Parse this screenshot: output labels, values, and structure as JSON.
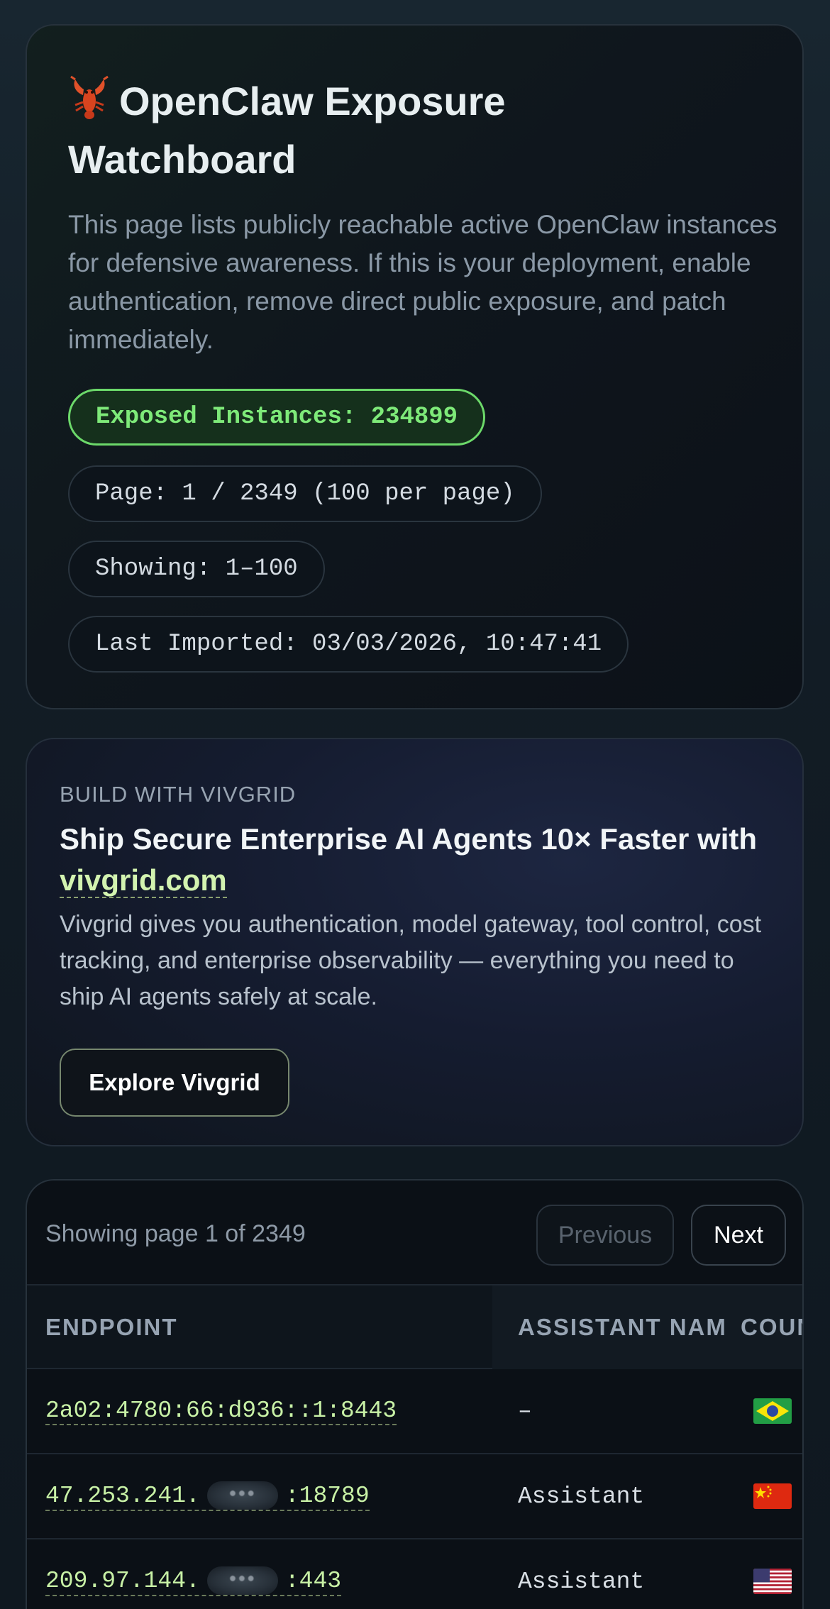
{
  "hero": {
    "title": "OpenClaw Exposure Watchboard",
    "description": "This page lists publicly reachable active OpenClaw instances for defensive awareness. If this is your deployment, enable authentication, remove direct public exposure, and patch immediately.",
    "exposed_label": "Exposed Instances: 234899",
    "page_label": "Page: 1 / 2349 (100 per page)",
    "showing_label": "Showing: 1–100",
    "imported_label": "Last Imported: 03/03/2026, 10:47:41"
  },
  "promo": {
    "eyebrow": "BUILD WITH VIVGRID",
    "title_prefix": "Ship Secure Enterprise AI Agents 10× Faster with ",
    "title_link": "vivgrid.com",
    "description": "Vivgrid gives you authentication, model gateway, tool control, cost tracking, and enterprise observability — everything you need to ship AI agents safely at scale.",
    "button": "Explore Vivgrid"
  },
  "table": {
    "status": "Showing page 1 of 2349",
    "prev_label": "Previous",
    "next_label": "Next",
    "columns": [
      "ENDPOINT",
      "ASSISTANT NAM",
      "COUN"
    ],
    "rows": [
      {
        "endpoint_prefix": "2a02:4780:66:d936::1:8443",
        "endpoint_suffix": "",
        "assistant": "–",
        "country": "Br",
        "flag": "brazil-flag-icon"
      },
      {
        "endpoint_prefix": "47.253.241.",
        "endpoint_suffix": ":18789",
        "assistant": "Assistant",
        "country": "C",
        "flag": "china-flag-icon"
      },
      {
        "endpoint_prefix": "209.97.144.",
        "endpoint_suffix": ":443",
        "assistant": "Assistant",
        "country": "U",
        "flag": "usa-flag-icon"
      }
    ]
  },
  "colors": {
    "accent_green": "#7eea79",
    "link_green": "#c8f1a6",
    "background": "#101820"
  }
}
